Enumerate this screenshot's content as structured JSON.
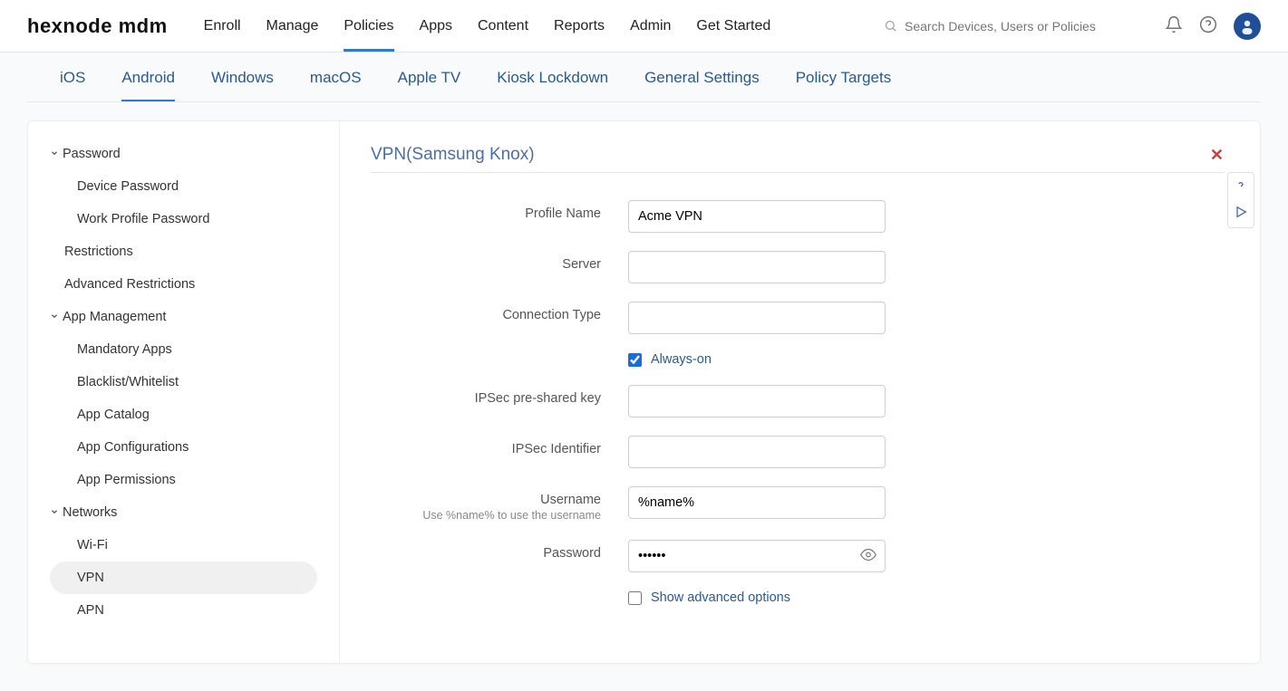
{
  "brand": "hexnode mdm",
  "main_nav": [
    "Enroll",
    "Manage",
    "Policies",
    "Apps",
    "Content",
    "Reports",
    "Admin",
    "Get Started"
  ],
  "main_nav_active": "Policies",
  "search_placeholder": "Search Devices, Users or Policies",
  "platform_tabs": [
    "iOS",
    "Android",
    "Windows",
    "macOS",
    "Apple TV",
    "Kiosk Lockdown",
    "General Settings",
    "Policy Targets"
  ],
  "platform_active": "Android",
  "sidebar": {
    "groups": [
      {
        "label": "Password",
        "items": [
          "Device Password",
          "Work Profile Password"
        ]
      },
      {
        "label": "Restrictions",
        "simple": true
      },
      {
        "label": "Advanced Restrictions",
        "simple": true
      },
      {
        "label": "App Management",
        "items": [
          "Mandatory Apps",
          "Blacklist/Whitelist",
          "App Catalog",
          "App Configurations",
          "App Permissions"
        ]
      },
      {
        "label": "Networks",
        "items": [
          "Wi-Fi",
          "VPN",
          "APN"
        ]
      }
    ],
    "active": "VPN"
  },
  "page_title": "VPN(Samsung Knox)",
  "form": {
    "profile_name": {
      "label": "Profile Name",
      "value": "Acme VPN"
    },
    "server": {
      "label": "Server",
      "value": "              "
    },
    "connection_type": {
      "label": "Connection Type",
      "value": ""
    },
    "always_on": {
      "label": "Always-on",
      "checked": true
    },
    "ipsec_psk": {
      "label": "IPSec pre-shared key",
      "value": "         "
    },
    "ipsec_id": {
      "label": "IPSec Identifier",
      "value": "         "
    },
    "username": {
      "label": "Username",
      "value": "%name%",
      "hint": "Use %name% to use the username"
    },
    "password": {
      "label": "Password",
      "value": "••••••"
    },
    "advanced": {
      "label": "Show advanced options",
      "checked": false
    }
  }
}
